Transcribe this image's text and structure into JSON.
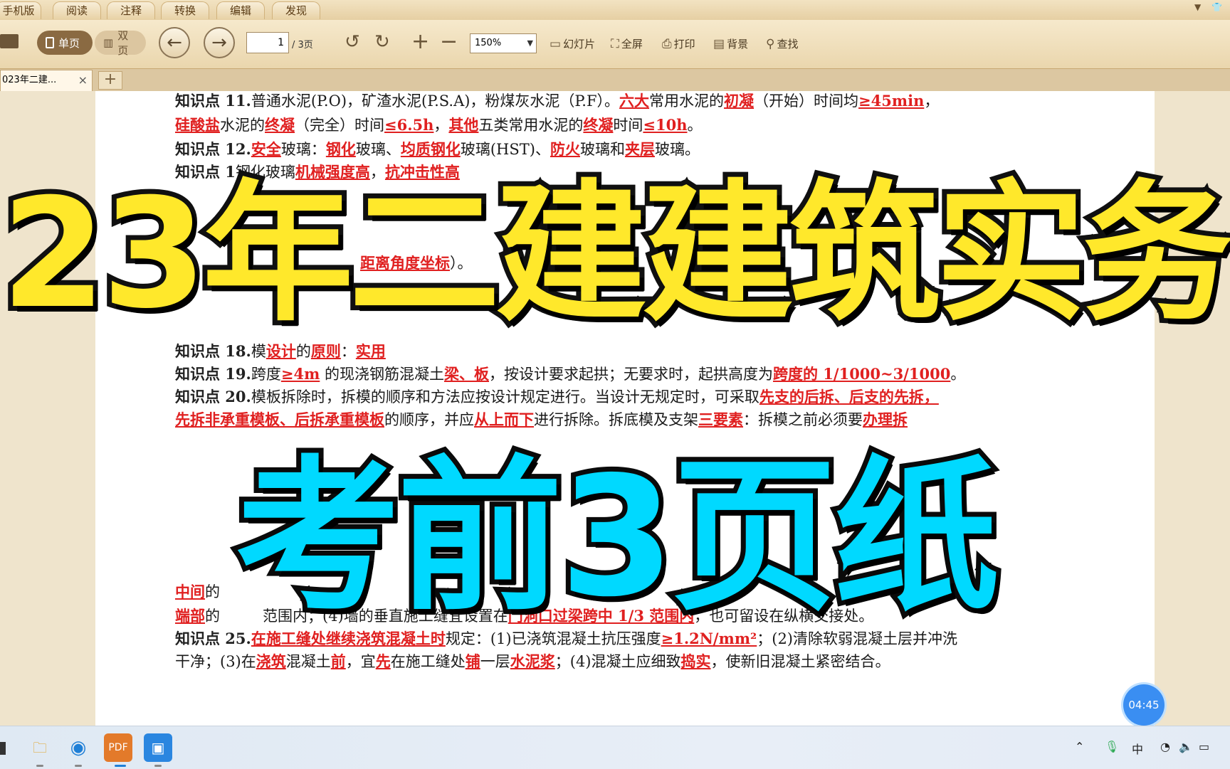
{
  "menu": {
    "tabs": [
      "手机版",
      "阅读",
      "注释",
      "转换",
      "编辑",
      "发现"
    ]
  },
  "toolbar": {
    "single_page": "单页",
    "double_page": "双页",
    "current_page": "1",
    "total_pages": "/ 3页",
    "zoom": "150%",
    "slideshow": "幻灯片",
    "fullscreen": "全屏",
    "print": "打印",
    "background": "背景",
    "find": "查找"
  },
  "tabs": {
    "doc_title": "023年二建...",
    "add": "+"
  },
  "document": {
    "line1": {
      "a": "知识点 11.",
      "b": "普通水泥(P.O)，矿渣水泥(P.S.A)，粉煤灰水泥（P.F）。",
      "c": "六大",
      "d": "常用水泥的",
      "e": "初凝",
      "f": "（开始）时间均",
      "g": "≥45min",
      "h": "，"
    },
    "line2": {
      "a": "硅酸盐",
      "b": "水泥的",
      "c": "终凝",
      "d": "（完全）时间",
      "e": "≤6.5h",
      "f": "，",
      "g": "其他",
      "h": "五类常用水泥的",
      "i": "终凝",
      "j": "时间",
      "k": "≤10h",
      "l": "。"
    },
    "line3": {
      "a": "知识点 12.",
      "b": "安全",
      "c": "玻璃：",
      "d": "钢化",
      "e": "玻璃、",
      "f": "均质钢化",
      "g": "玻璃(HST)、",
      "h": "防火",
      "i": "玻璃和",
      "j": "夹层",
      "k": "玻璃。"
    },
    "line4": {
      "a": "知识点 1",
      "b": "钢化玻璃",
      "c": "机械强度高",
      "d": "，",
      "e": "抗冲击性高"
    },
    "line5": {
      "a": "距离角度坐标",
      "b": "）。"
    },
    "line6": {
      "a": "知识点 18.",
      "b": "模",
      "c": "设计",
      "d": "的",
      "e": "原则",
      "f": "：",
      "g": "实用"
    },
    "line7": {
      "a": "知识点 19.",
      "b": "跨度",
      "c": "≥4m",
      "d": " 的现浇钢筋混凝土",
      "e": "梁、板",
      "f": "，按设计要求起拱；无要求时，起拱高度为",
      "g": "跨度的 1/1000~3/1000",
      "h": "。"
    },
    "line8": {
      "a": "知识点 20.",
      "b": "模板拆除时，拆模的顺序和方法应按设计规定进行。当设计无规定时，可采取",
      "c": "先支的后拆、后支的先拆，"
    },
    "line9": {
      "a": "先拆非承重模板、后拆承重模板",
      "b": "的顺序，并应",
      "c": "从上而下",
      "d": "进行拆除。拆底模及支架",
      "e": "三要素",
      "f": "：拆模之前必须要",
      "g": "办理拆"
    },
    "line10": {
      "a": "中间",
      "b": "的"
    },
    "line11": {
      "a": "端部",
      "b": "的",
      "c": "范围内；(4)墙的垂直施工缝宜设置在",
      "d": "门洞口过梁跨中 1/3 范围内",
      "e": "，也可留设在纵横交接处。"
    },
    "line12": {
      "a": "知识点 25.",
      "b": "在施工缝处继续浇筑混凝土时",
      "c": "规定：(1)已浇筑混凝土抗压强度",
      "d": "≥1.2N/mm²",
      "e": "；(2)清除软弱混凝土层并冲洗"
    },
    "line13": {
      "a": "干净；(3)在",
      "b": "浇筑",
      "c": "混凝土",
      "d": "前",
      "e": "，宜",
      "f": "先",
      "g": "在施工缝处",
      "h": "铺",
      "i": "一层",
      "j": "水泥浆",
      "k": "；(4)混凝土应细致",
      "l": "捣实",
      "m": "，使新旧混凝土紧密结合。"
    }
  },
  "overlay": {
    "title": "23年二建建筑实务",
    "subtitle": "考前3页纸",
    "timer": "04:45"
  },
  "taskbar": {
    "ime": "中",
    "apps": [
      "file-explorer",
      "edge",
      "pdf-reader",
      "photos"
    ]
  },
  "colors": {
    "title_yellow": "#ffe82b",
    "subtitle_cyan": "#00d9ff",
    "highlight_red": "#e02020"
  }
}
